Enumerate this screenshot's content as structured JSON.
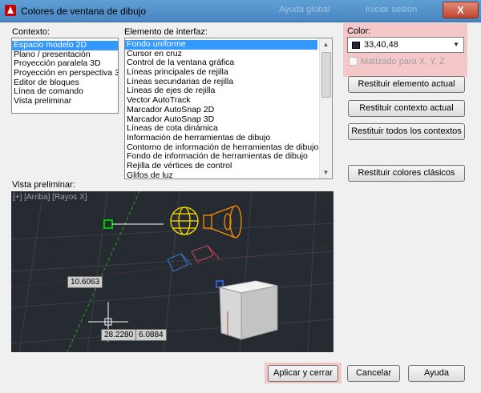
{
  "window": {
    "title": "Colores de ventana de dibujo",
    "background_title_1": "Ayuda global",
    "background_title_2": "Iniciar sesión",
    "close_glyph": "X"
  },
  "context": {
    "label": "Contexto:",
    "items": [
      "Espacio modelo 2D",
      "Plano / presentación",
      "Proyección paralela 3D",
      "Proyección en perspectiva 3D",
      "Editor de bloques",
      "Línea de comando",
      "Vista preliminar"
    ],
    "selected_index": 0
  },
  "interface": {
    "label": "Elemento de interfaz:",
    "items": [
      "Fondo uniforme",
      "Cursor en cruz",
      "Control de la ventana gráfica",
      "Líneas principales de rejilla",
      "Líneas secundarias de rejilla",
      "Líneas de ejes de rejilla",
      "Vector AutoTrack",
      "Marcador AutoSnap 2D",
      "Marcador AutoSnap 3D",
      "Líneas de cota dinámica",
      "Información de herramientas de dibujo",
      "Contorno de información de herramientas de dibujo",
      "Fondo de información de herramientas de dibujo",
      "Rejilla de vértices de control",
      "Glifos de luz"
    ],
    "selected_index": 0
  },
  "color": {
    "label": "Color:",
    "value": "33,40,48",
    "swatch": "#21282f",
    "tint_label": "Matizado para X, Y, Z",
    "tint_checked": false,
    "tint_enabled": false
  },
  "buttons": {
    "restore_item": "Restituir elemento actual",
    "restore_context": "Restituir contexto actual",
    "restore_all": "Restituir todos los contextos",
    "restore_classic": "Restituir colores clásicos",
    "apply": "Aplicar y cerrar",
    "cancel": "Cancelar",
    "help": "Ayuda"
  },
  "preview": {
    "label": "Vista preliminar:",
    "viewport_label": "[+] [Arriba] [Rayos X]",
    "dim_vertical": "10.6063",
    "coord_x": "28.2280",
    "coord_y": "6.0884",
    "background": "#21282f"
  },
  "colors": {
    "highlight": "#f4c7c8",
    "selection": "#3399ff",
    "grid_axis": "#2aa02a",
    "light_glyph": "#ffe000",
    "spot_glyph": "#ff8c00"
  }
}
